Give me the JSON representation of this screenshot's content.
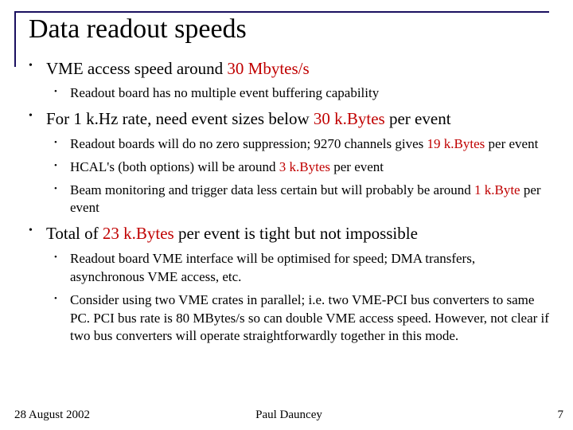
{
  "title": "Data readout speeds",
  "b1": {
    "pre": "VME access speed around ",
    "hl": "30 Mbytes/s",
    "s1": "Readout board has no multiple event buffering capability"
  },
  "b2": {
    "pre": "For 1 k.Hz rate, need event sizes below ",
    "hl": "30 k.Bytes",
    "post": " per event",
    "s1a": "Readout boards will do no zero suppression; 9270 channels gives ",
    "s1hl": "19 k.Bytes",
    "s1b": " per event",
    "s2a": "HCAL's (both options) will be around ",
    "s2hl": "3 k.Bytes",
    "s2b": " per event",
    "s3a": "Beam monitoring and trigger data less certain but will probably be around ",
    "s3hl": "1 k.Byte",
    "s3b": " per event"
  },
  "b3": {
    "pre": "Total of ",
    "hl": "23 k.Bytes",
    "post": " per event is tight but not impossible",
    "s1": "Readout board VME interface will be optimised for speed; DMA transfers, asynchronous VME access, etc.",
    "s2": "Consider using two VME crates in parallel; i.e. two VME-PCI bus converters to same PC. PCI bus rate is 80 MBytes/s so can double VME access speed. However, not clear if two bus converters will operate straightforwardly together in this mode."
  },
  "footer": {
    "date": "28 August 2002",
    "author": "Paul Dauncey",
    "page": "7"
  }
}
